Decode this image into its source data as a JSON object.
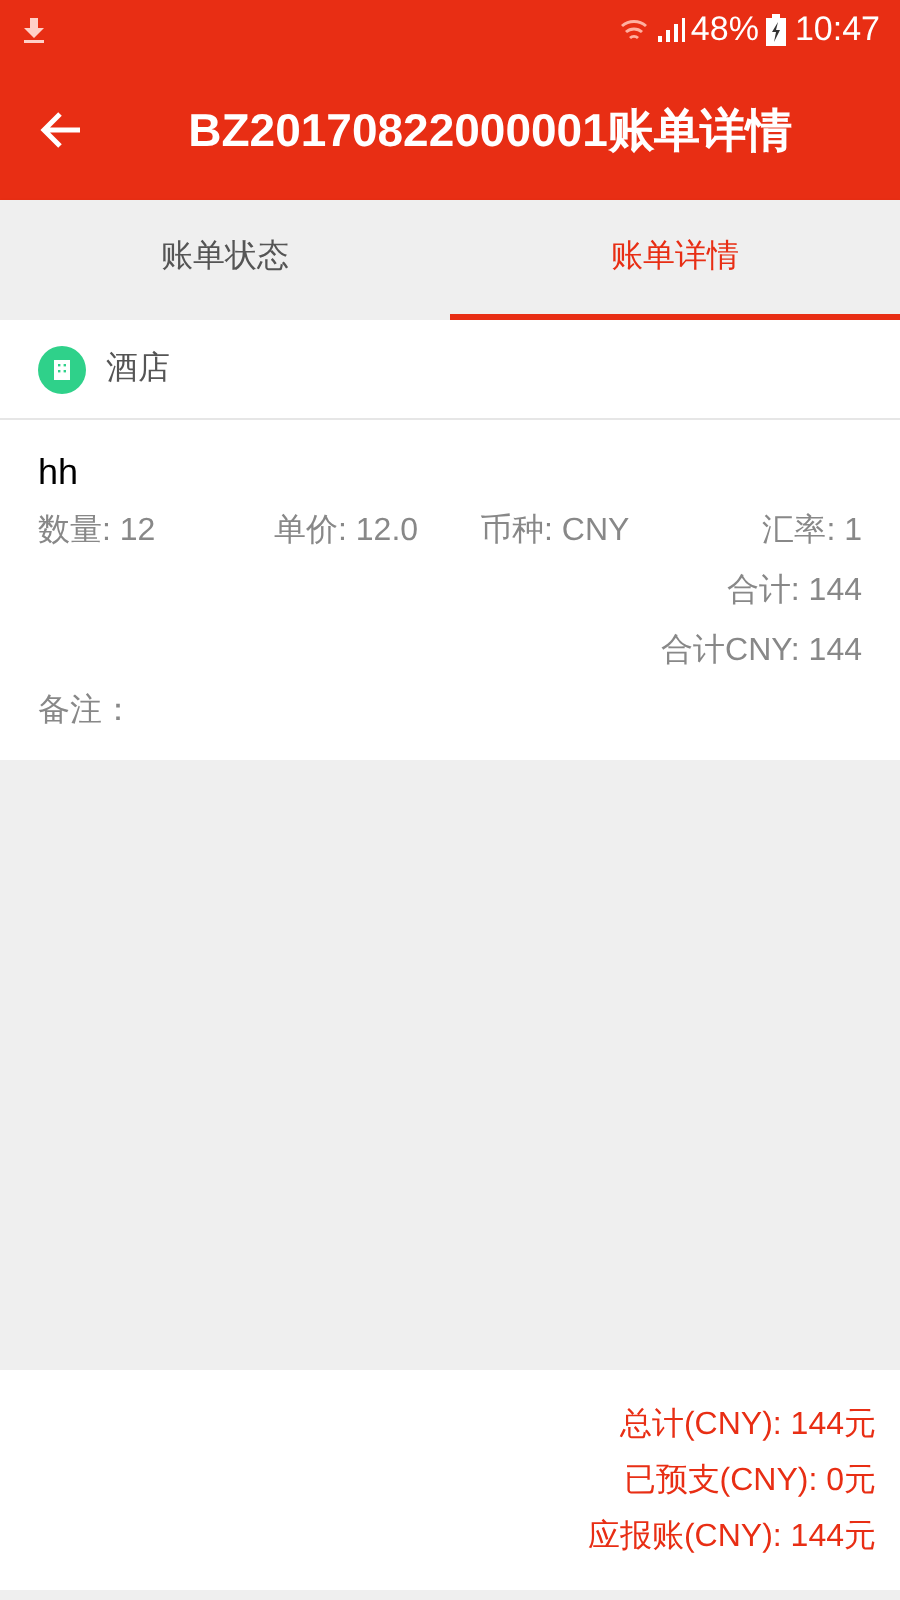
{
  "status_bar": {
    "battery": "48%",
    "time": "10:47"
  },
  "app_bar": {
    "title": "BZ20170822000001账单详情"
  },
  "tabs": [
    {
      "label": "账单状态",
      "selected": false
    },
    {
      "label": "账单详情",
      "selected": true
    }
  ],
  "category": {
    "label": "酒店"
  },
  "item": {
    "name": "hh",
    "quantity": "数量: 12",
    "unit_price": "单价: 12.0",
    "currency": "币种: CNY",
    "rate": "汇率: 1",
    "subtotal": "合计: 144",
    "subtotal_cny": "合计CNY: 144",
    "note": "备注："
  },
  "summary": [
    "总计(CNY): 144元",
    "已预支(CNY): 0元",
    "应报账(CNY): 144元"
  ]
}
